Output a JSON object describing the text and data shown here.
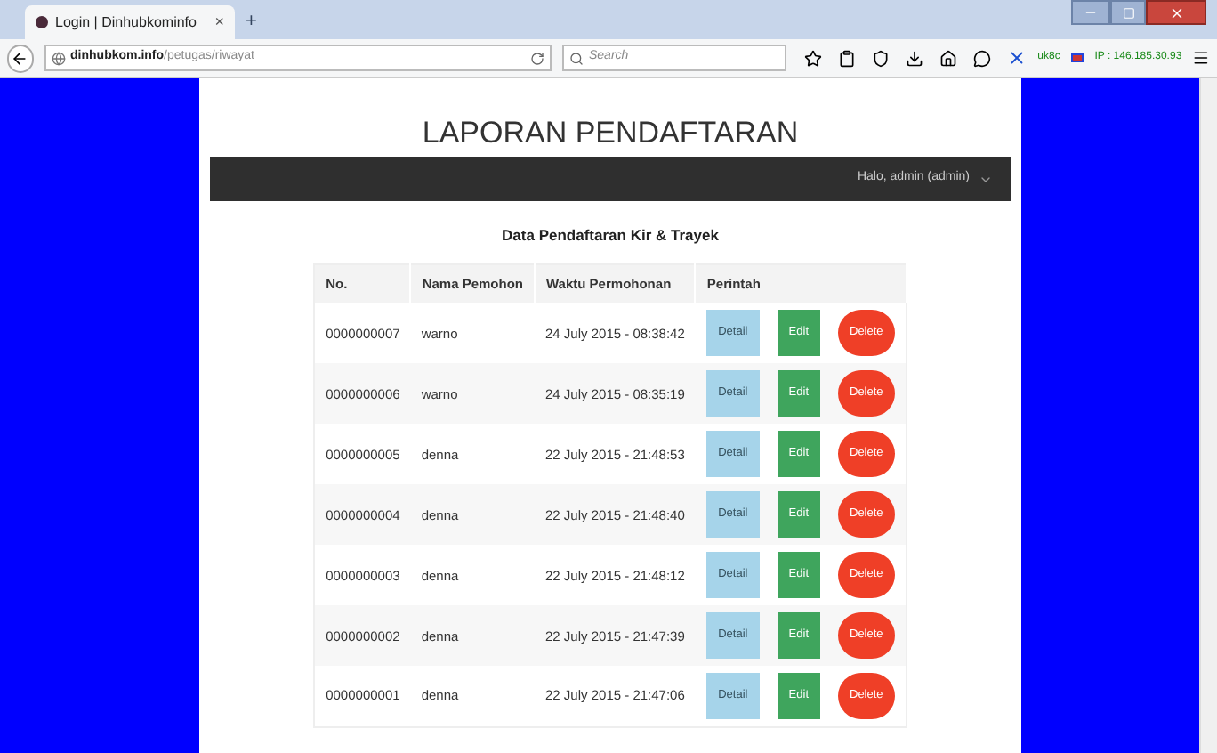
{
  "browser": {
    "tab_title": "Login | Dinhubkominfo",
    "tab_close": "×",
    "new_tab": "+",
    "url_domain": "dinhubkom.info",
    "url_path": "/petugas/riwayat",
    "search_placeholder": "Search",
    "addon_text": "uk8c",
    "ip_text": "IP : 146.185.30.93"
  },
  "page": {
    "title": "LAPORAN PENDAFTARAN",
    "user_menu": "Halo, admin (admin)",
    "heading": "Data Pendaftaran Kir & Trayek"
  },
  "table": {
    "columns": [
      "No.",
      "Nama Pemohon",
      "Waktu Permohonan",
      "Perintah"
    ],
    "rows": [
      {
        "no": "0000000007",
        "name": "warno",
        "time": "24 July 2015 - 08:38:42",
        "actions": [
          {
            "kind": "detail",
            "label": "Detail"
          },
          {
            "kind": "edit",
            "label": "Edit"
          },
          {
            "kind": "delete",
            "label": "Delete"
          }
        ]
      },
      {
        "no": "0000000006",
        "name": "warno",
        "time": "24 July 2015 - 08:35:19",
        "actions": [
          {
            "kind": "detail",
            "label": "Detail"
          },
          {
            "kind": "edit",
            "label": "Edit"
          },
          {
            "kind": "delete",
            "label": "Delete"
          }
        ]
      },
      {
        "no": "0000000005",
        "name": "denna",
        "time": "22 July 2015 - 21:48:53",
        "actions": [
          {
            "kind": "detail",
            "label": "Detail"
          },
          {
            "kind": "edit",
            "label": "Edit"
          },
          {
            "kind": "delete",
            "label": "Delete"
          }
        ]
      },
      {
        "no": "0000000004",
        "name": "denna",
        "time": "22 July 2015 - 21:48:40",
        "actions": [
          {
            "kind": "detail",
            "label": "Detail"
          },
          {
            "kind": "edit",
            "label": "Edit"
          },
          {
            "kind": "delete",
            "label": "Delete"
          }
        ]
      },
      {
        "no": "0000000003",
        "name": "denna",
        "time": "22 July 2015 - 21:48:12",
        "actions": [
          {
            "kind": "detail",
            "label": "Detail"
          },
          {
            "kind": "edit",
            "label": "Edit"
          },
          {
            "kind": "delete",
            "label": "Delete"
          }
        ]
      },
      {
        "no": "0000000002",
        "name": "denna",
        "time": "22 July 2015 - 21:47:39",
        "actions": [
          {
            "kind": "detail",
            "label": "Detail"
          },
          {
            "kind": "edit",
            "label": "Edit"
          },
          {
            "kind": "delete",
            "label": "Delete"
          }
        ]
      },
      {
        "no": "0000000001",
        "name": "denna",
        "time": "22 July 2015 - 21:47:06",
        "actions": [
          {
            "kind": "detail",
            "label": "Detail"
          },
          {
            "kind": "edit",
            "label": "Edit"
          },
          {
            "kind": "delete",
            "label": "Delete"
          }
        ]
      }
    ]
  }
}
